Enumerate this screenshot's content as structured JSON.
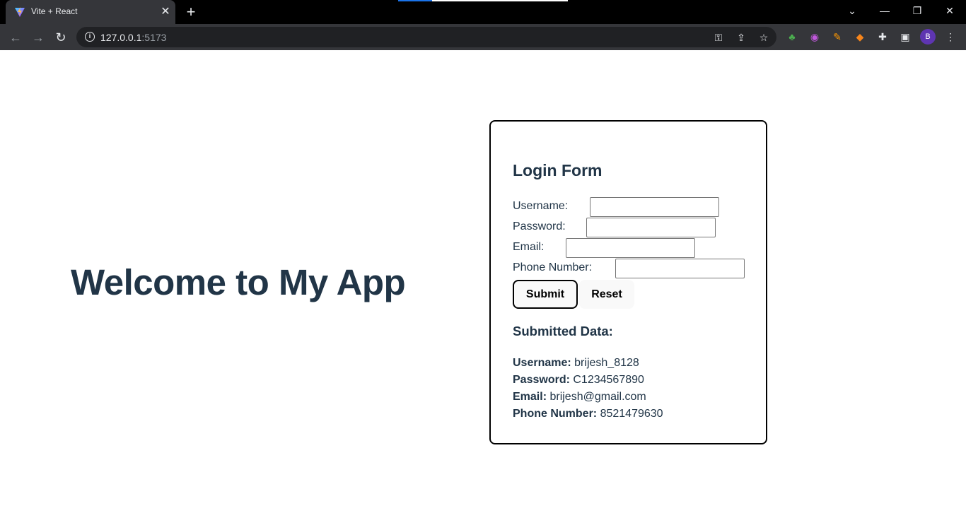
{
  "browser": {
    "tab_title": "Vite + React",
    "tab_close": "✕",
    "new_tab": "+",
    "url_host": "127.0.0.1",
    "url_port": ":5173",
    "profile_initial": "B",
    "icons": [
      "vite-favicon",
      "back-arrow-icon",
      "forward-arrow-icon",
      "reload-icon",
      "info-icon",
      "key-icon",
      "share-icon",
      "star-icon",
      "tree-extension-icon",
      "circle-extension-icon",
      "pen-extension-icon",
      "metamask-extension-icon",
      "puzzle-extension-icon",
      "sidebar-icon",
      "menu-dots-icon"
    ],
    "window_controls": {
      "dropdown": "⌄",
      "minimize": "—",
      "restore": "❐",
      "close": "✕"
    }
  },
  "page": {
    "welcome": "Welcome to My App",
    "text_color": "#213547"
  },
  "form": {
    "title": "Login Form",
    "fields": {
      "username": {
        "label": "Username:",
        "value": ""
      },
      "password": {
        "label": "Password:",
        "value": ""
      },
      "email": {
        "label": "Email:",
        "value": ""
      },
      "phone": {
        "label": "Phone Number:",
        "value": ""
      }
    },
    "submit_label": "Submit",
    "reset_label": "Reset"
  },
  "submitted": {
    "title": "Submitted Data:",
    "username_label": "Username:",
    "username_value": "brijesh_8128",
    "password_label": "Password:",
    "password_value": "C1234567890",
    "email_label": "Email:",
    "email_value": "brijesh@gmail.com",
    "phone_label": "Phone Number:",
    "phone_value": "8521479630"
  }
}
